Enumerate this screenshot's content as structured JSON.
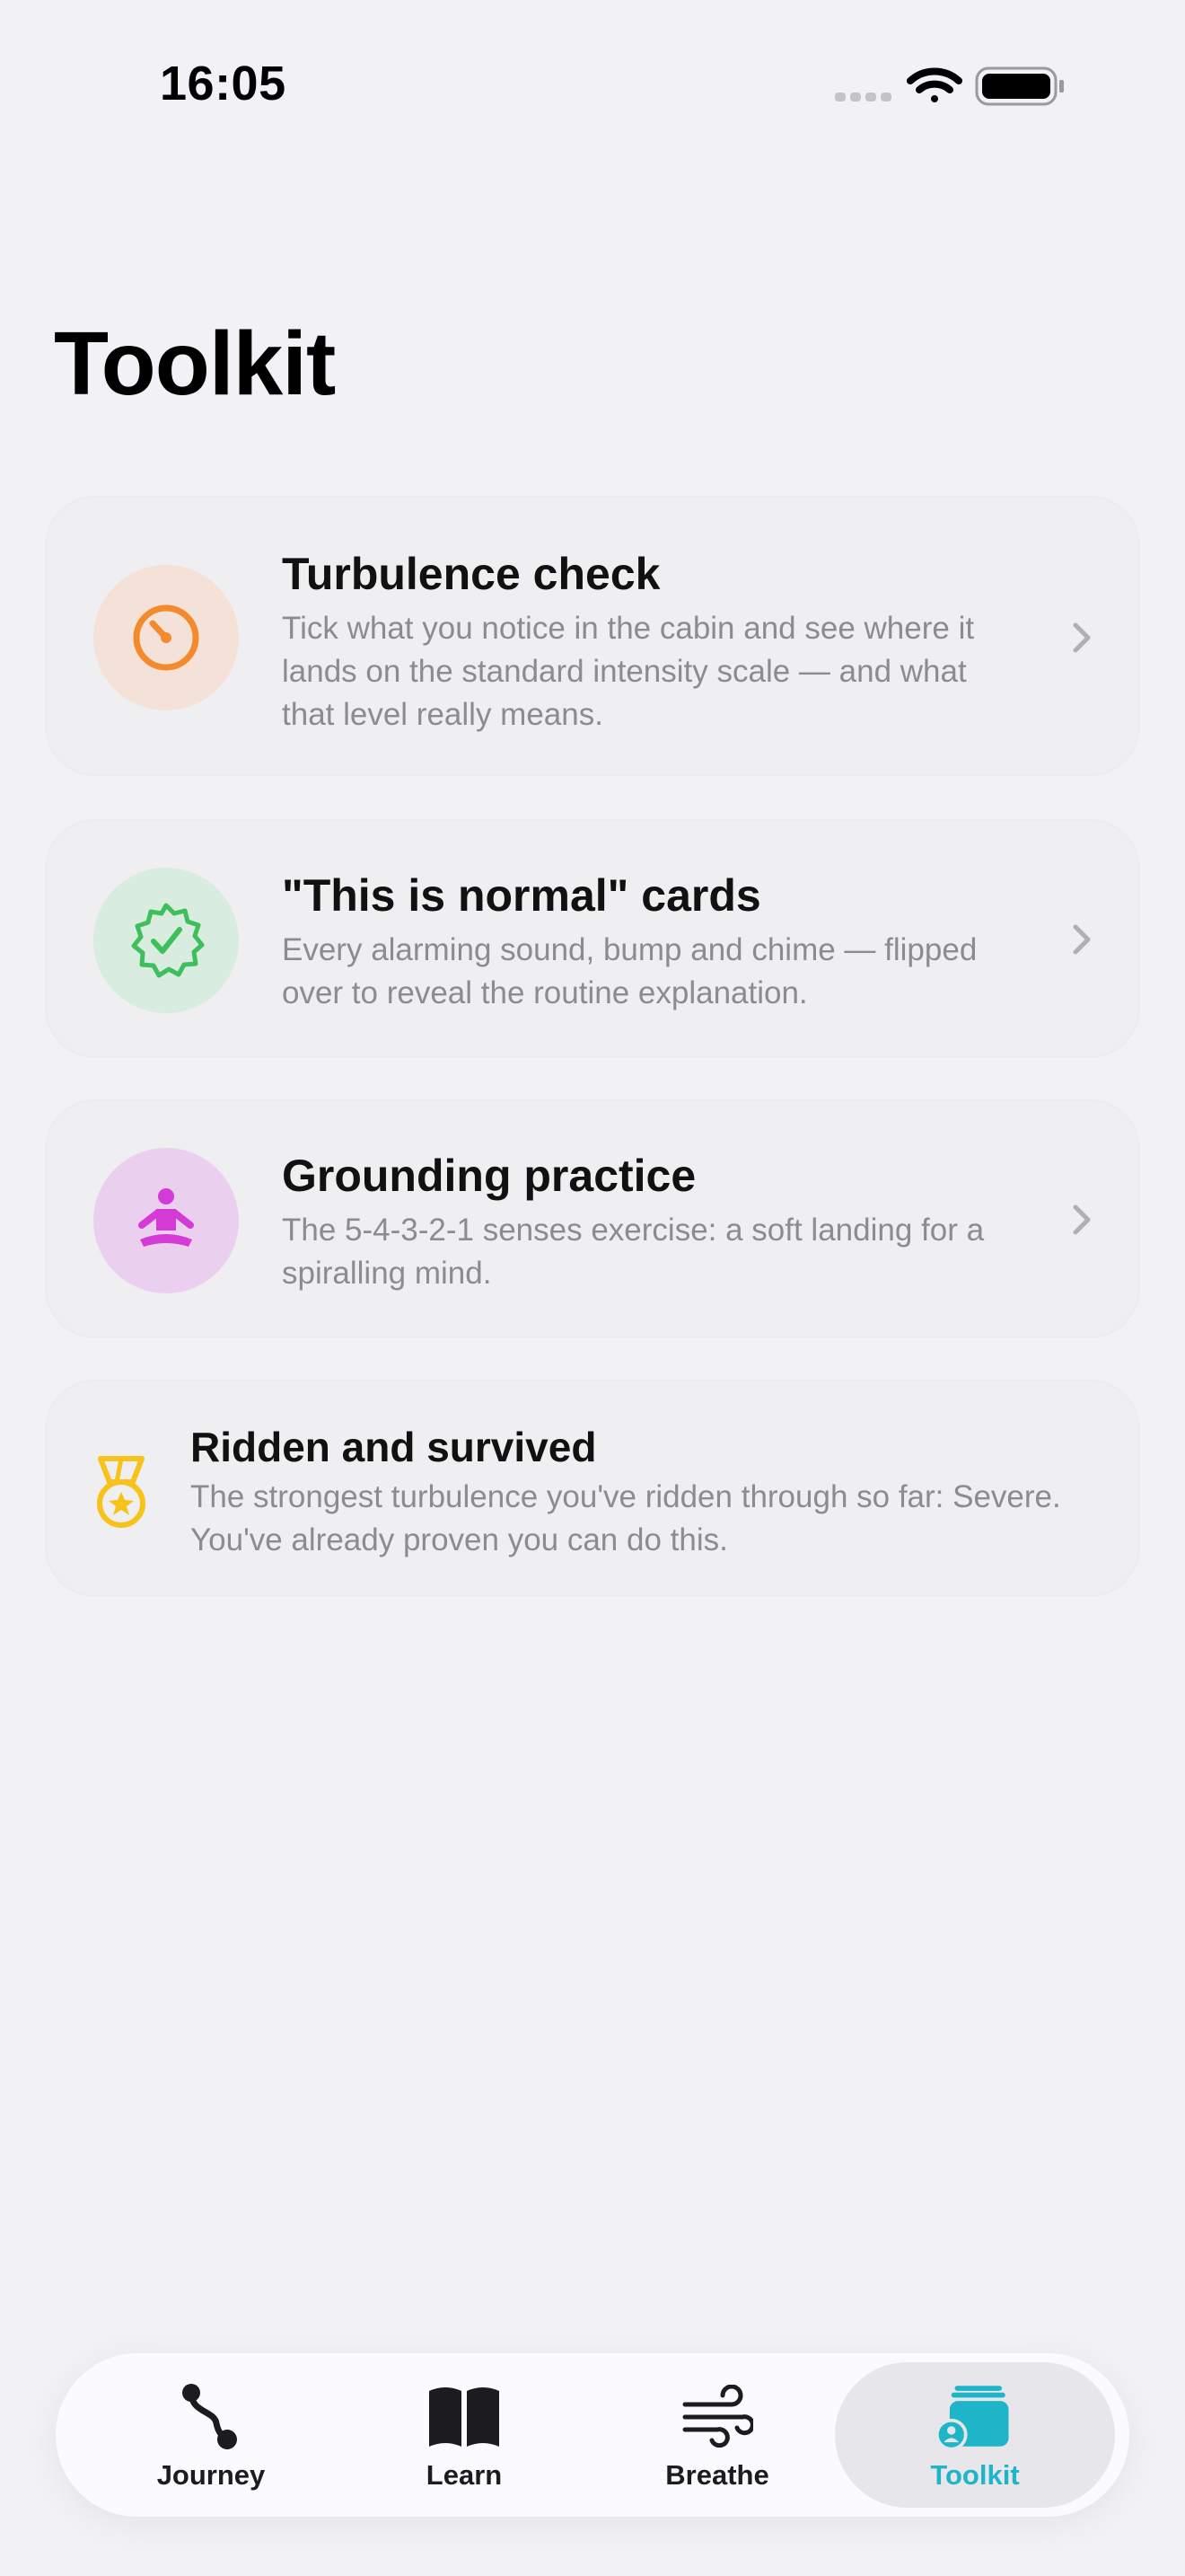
{
  "status": {
    "time": "16:05"
  },
  "page": {
    "title": "Toolkit"
  },
  "cards": [
    {
      "title": "Turbulence check",
      "description": "Tick what you notice in the cabin and see where it lands on the standard intensity scale — and what that level really means.",
      "icon": "gauge-icon",
      "accent": "#F48A2E",
      "icon_bg": "#F4E2D9"
    },
    {
      "title": "\"This is normal\" cards",
      "description": "Every alarming sound, bump and chime — flipped over to reveal the routine explanation.",
      "icon": "checkmark-seal-icon",
      "accent": "#3FBE5C",
      "icon_bg": "#D8ECDF"
    },
    {
      "title": "Grounding practice",
      "description": "The 5-4-3-2-1 senses exercise: a soft landing for a spiralling mind.",
      "icon": "meditation-figure-icon",
      "accent": "#D33AD6",
      "icon_bg": "#EBCFEE"
    }
  ],
  "achievement": {
    "title": "Ridden and survived",
    "description": "The strongest turbulence you've ridden through so far: Severe. You've already proven you can do this.",
    "icon": "medal-icon",
    "accent": "#F7C21A"
  },
  "tabbar": {
    "tabs": [
      {
        "label": "Journey",
        "icon": "route-icon"
      },
      {
        "label": "Learn",
        "icon": "book-icon"
      },
      {
        "label": "Breathe",
        "icon": "wind-icon"
      },
      {
        "label": "Toolkit",
        "icon": "stack-person-icon",
        "active": true
      }
    ],
    "active_color": "#1FB5C8"
  }
}
